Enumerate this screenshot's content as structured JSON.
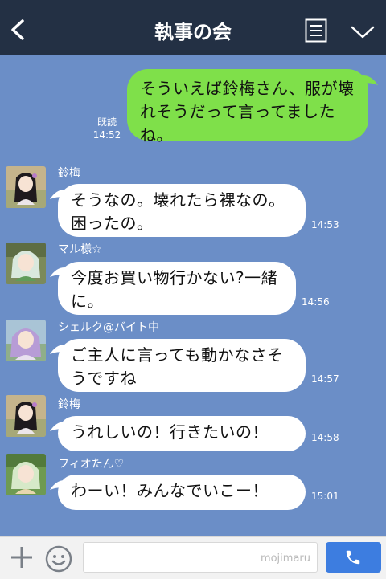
{
  "header": {
    "title": "執事の会"
  },
  "messages": [
    {
      "side": "out",
      "text": "そういえば鈴梅さん、服が壊れそうだって言ってましたね。",
      "read": "既読",
      "time": "14:52"
    },
    {
      "side": "in",
      "sender": "鈴梅",
      "text": "そうなの。壊れたら裸なの。困ったの。",
      "time": "14:53"
    },
    {
      "side": "in",
      "sender": "マル様☆",
      "text": "今度お買い物行かない?一緒に。",
      "time": "14:56"
    },
    {
      "side": "in",
      "sender": "シェルク@バイト中",
      "text": "ご主人に言っても動かなさそうですね",
      "time": "14:57"
    },
    {
      "side": "in",
      "sender": "鈴梅",
      "text": "うれしいの！行きたいの！",
      "time": "14:58"
    },
    {
      "side": "in",
      "sender": "フィオたん♡",
      "text": "わーい！みんなでいこー！",
      "time": "15:01"
    }
  ],
  "footer": {
    "watermark": "mojimaru"
  },
  "colors": {
    "header": "#233044",
    "chat_bg": "#6b8ec7",
    "outgoing": "#7fe04a",
    "incoming": "#ffffff",
    "call_button": "#3d7de0"
  }
}
